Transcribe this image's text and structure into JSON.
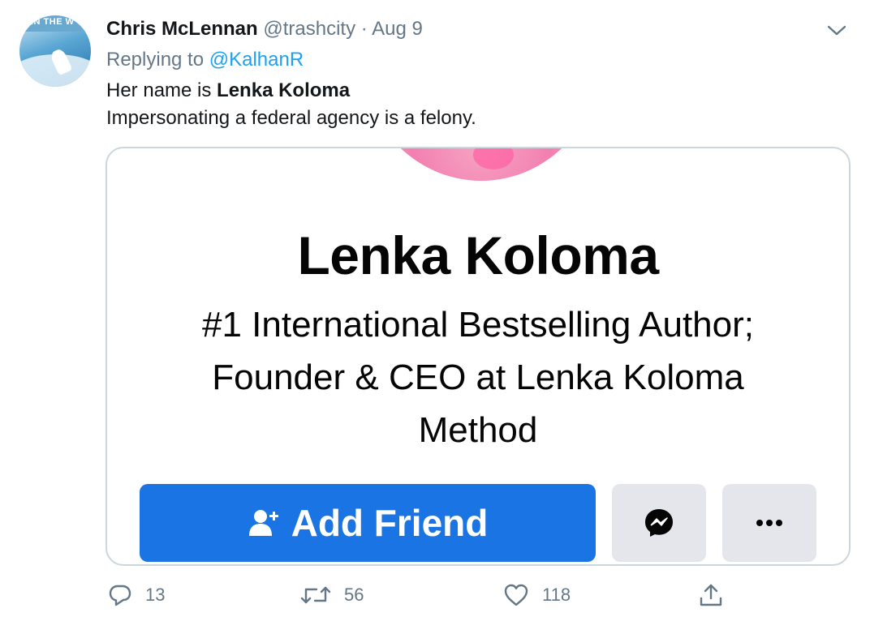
{
  "tweet": {
    "author_name": "Chris McLennan",
    "author_handle": "@trashcity",
    "separator": "·",
    "date": "Aug 9",
    "replying_prefix": "Replying to",
    "replying_to": "@KalhanR",
    "text_line1_prefix": "Her name is ",
    "text_line1_bold": "Lenka Koloma",
    "text_line2": "Impersonating a federal agency is a felony.",
    "avatar_text": "IN THE W"
  },
  "card": {
    "profile_name": "Lenka Koloma",
    "bio": "#1 International Bestselling Author; Founder & CEO at Lenka Koloma Method",
    "add_friend_label": "Add Friend",
    "messenger_icon": "messenger-icon",
    "more_icon": "more-dots-icon"
  },
  "actions": {
    "reply_count": "13",
    "retweet_count": "56",
    "like_count": "118",
    "icons": [
      "reply-icon",
      "retweet-icon",
      "like-icon",
      "share-icon"
    ]
  },
  "colors": {
    "link": "#1da1f2",
    "muted": "#657786",
    "facebook_blue": "#1b74e4",
    "button_gray": "#e4e6eb",
    "card_border": "#ccd6dd"
  }
}
